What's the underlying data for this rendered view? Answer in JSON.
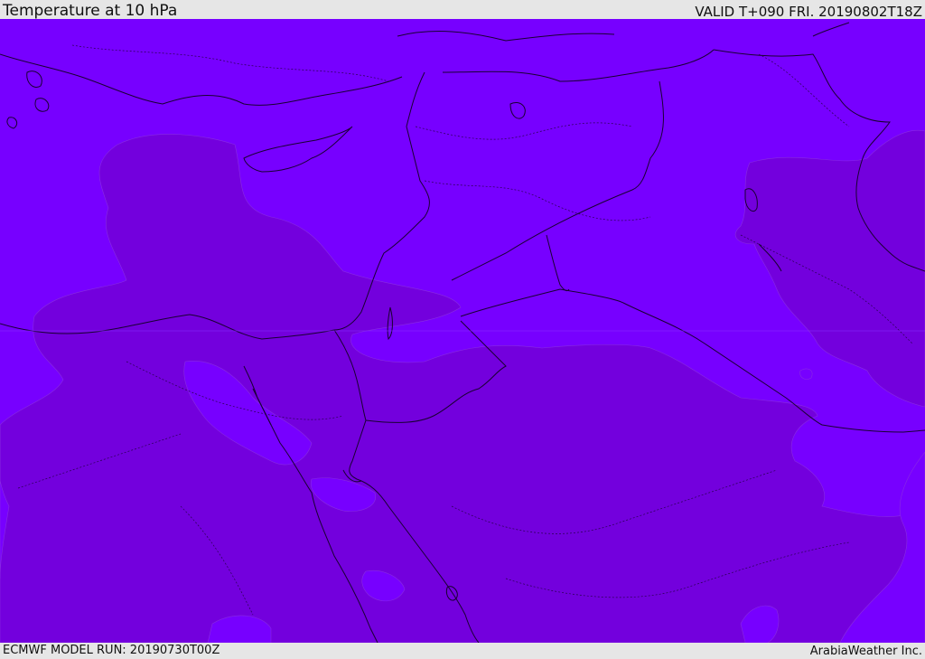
{
  "header": {
    "title": "Temperature at 10 hPa",
    "valid": "VALID T+090 FRI. 20190802T18Z"
  },
  "footer": {
    "model_run": "ECMWF MODEL RUN: 20190730T00Z",
    "credit": "ArabiaWeather Inc."
  },
  "map": {
    "colors": {
      "field_light": "#7700ff",
      "field_dark": "#7300dd",
      "border": "#1a0033"
    }
  }
}
